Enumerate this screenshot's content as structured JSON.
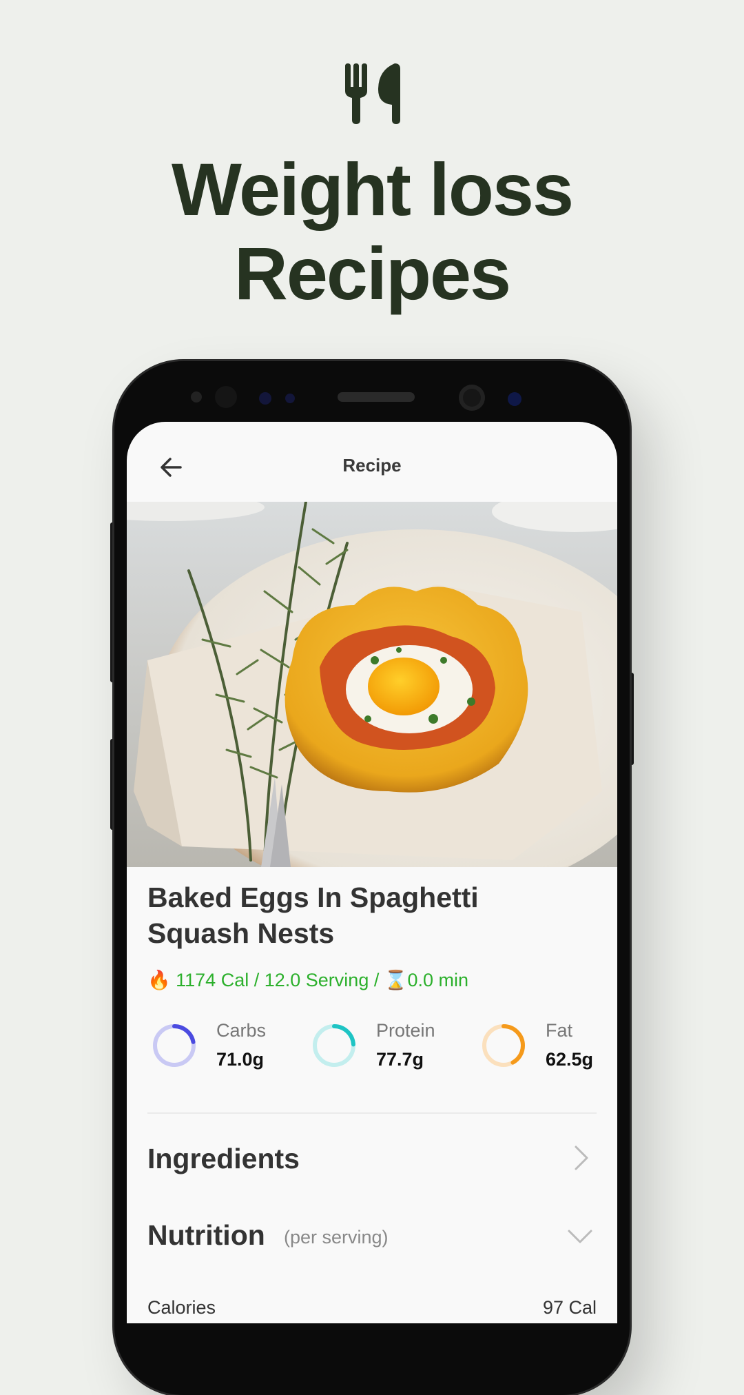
{
  "promo": {
    "icon": "fork-knife-icon",
    "headline_line1": "Weight loss",
    "headline_line2": "Recipes"
  },
  "appbar": {
    "back_icon": "arrow-left-icon",
    "title": "Recipe"
  },
  "recipe": {
    "title": "Baked Eggs In Spaghetti Squash Nests",
    "meta": {
      "calories_icon": "🔥",
      "calories": "1174 Cal",
      "separator": " / ",
      "servings": "12.0 Serving",
      "time_icon": "⌛",
      "time": "0.0 min"
    },
    "macros": [
      {
        "name": "Carbs",
        "value": "71.0g",
        "fraction": 0.22,
        "color": "#4b4be0",
        "track": "#c9c9f4"
      },
      {
        "name": "Protein",
        "value": "77.7g",
        "fraction": 0.24,
        "color": "#1ec4c4",
        "track": "#c3eeee"
      },
      {
        "name": "Fat",
        "value": "62.5g",
        "fraction": 0.42,
        "color": "#f59a1b",
        "track": "#fbe0bd"
      }
    ]
  },
  "sections": {
    "ingredients": "Ingredients",
    "nutrition": "Nutrition",
    "nutrition_sub": "(per serving)"
  },
  "nutrition_rows": [
    {
      "label": "Calories",
      "value": "97 Cal"
    }
  ],
  "colors": {
    "headline": "#263321",
    "meta_green": "#2cb02c",
    "background": "#eef0ec"
  }
}
